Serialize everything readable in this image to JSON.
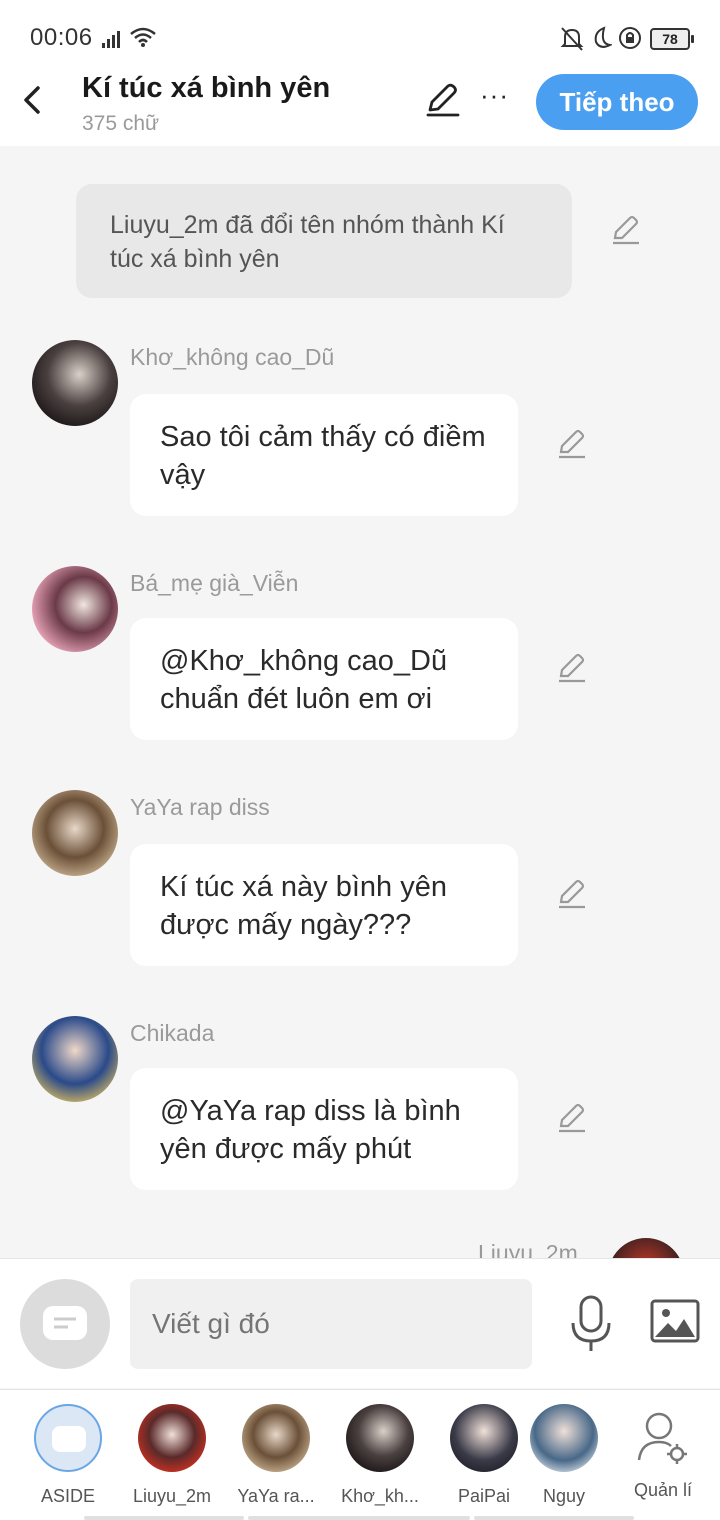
{
  "status_bar": {
    "time": "00:06",
    "battery": "78"
  },
  "header": {
    "title": "Kí túc xá bình yên",
    "subtitle": "375 chữ",
    "next_label": "Tiếp theo",
    "more_label": "···"
  },
  "system_message": "Liuyu_2m đã đổi tên nhóm thành Kí túc xá bình yên",
  "messages": [
    {
      "sender": "Khơ_không cao_Dũ",
      "text": "Sao tôi cảm thấy có điềm vậy"
    },
    {
      "sender": "Bá_mẹ già_Viễn",
      "text": "@Khơ_không cao_Dũ chuẩn đét luôn em ơi"
    },
    {
      "sender": "YaYa rap diss",
      "text": "Kí túc xá này bình yên được mấy ngày???"
    },
    {
      "sender": "Chikada",
      "text": "@YaYa rap diss là bình yên được mấy phút"
    }
  ],
  "partial_message": {
    "sender": "Liuyu_2m"
  },
  "input": {
    "placeholder": "Viết gì đó"
  },
  "characters": [
    {
      "label": "ASIDE"
    },
    {
      "label": "Liuyu_2m"
    },
    {
      "label": "YaYa ra..."
    },
    {
      "label": "Khơ_kh..."
    },
    {
      "label": "PaiPai"
    },
    {
      "label": "Nguy"
    }
  ],
  "manage_label": "Quản lí",
  "colors": {
    "accent": "#4a9ff0",
    "bubble": "#ffffff",
    "system_bubble": "#e8e8e8",
    "background": "#f5f5f5"
  }
}
